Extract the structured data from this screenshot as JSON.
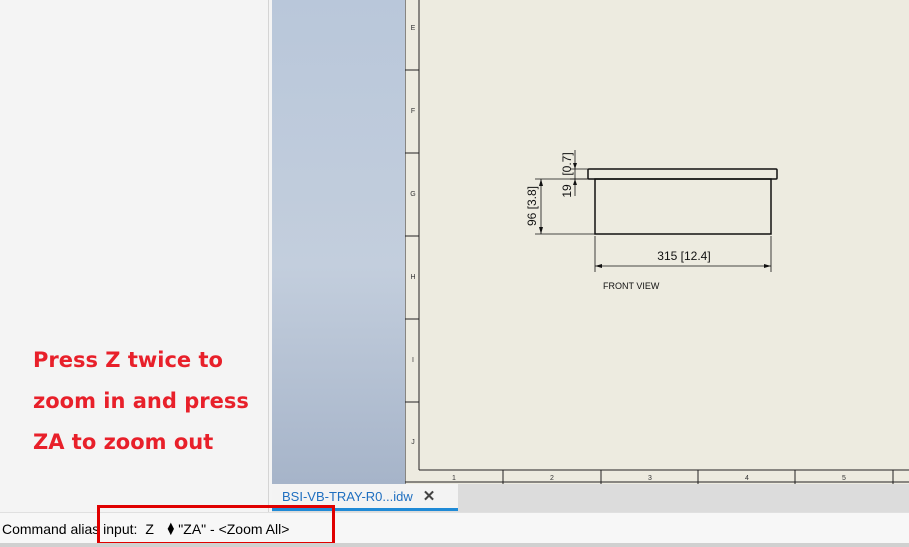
{
  "instructions": {
    "lines": [
      "Press Z twice to",
      "zoom in and press",
      "ZA to zoom out"
    ],
    "color": "#e8202a"
  },
  "sheet": {
    "row_labels": [
      "E",
      "F",
      "G",
      "H",
      "I",
      "J"
    ],
    "column_labels": [
      "1",
      "2",
      "3",
      "4",
      "5"
    ]
  },
  "drawing": {
    "dim_width": "315 [12.4]",
    "dim_height": "96 [3.8]",
    "dim_body": "19",
    "dim_lip": "[0.7]",
    "view_label": "FRONT VIEW"
  },
  "tabs": {
    "document": "BSI-VB-TRAY-R0...idw",
    "close_icon": "close-icon"
  },
  "command": {
    "label": "Command alias input:",
    "value": "Z",
    "suggestion": "\"ZA\" - <Zoom All>",
    "highlight_color": "#e00000"
  }
}
